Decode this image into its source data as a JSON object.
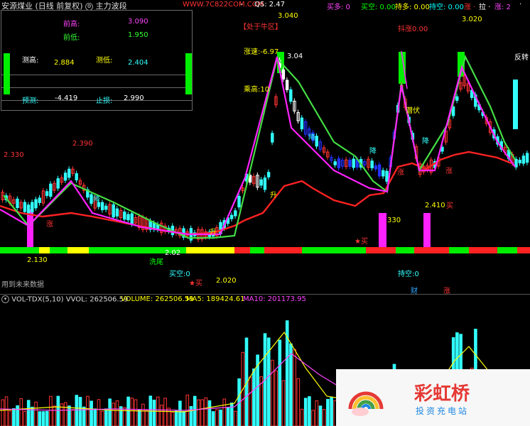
{
  "header": {
    "stock_name": "安源煤业",
    "period_label": "(日线 前复权)",
    "indicator_name": "主力波段",
    "watermark": "WWW.7C822COM.COM",
    "dash": "-",
    "qs": "QS: 2.47",
    "buy_many": "买多: 0",
    "buy_empty": "买空: 0.00",
    "hold_many": "持多: 0.00",
    "hold_empty": "持空: 0.00",
    "zhang": "涨 ·",
    "la": "拉 ·",
    "zhang2": "涨: 2",
    "tail": "·"
  },
  "info_panel": {
    "prev_high_label": "前高:",
    "prev_high_value": "3.090",
    "prev_low_label": "前低:",
    "prev_low_value": "1.950",
    "measure_high_label": "测高:",
    "measure_high_value": "2.884",
    "measure_low_label": "测低:",
    "measure_low_value": "2.404",
    "forecast_label": "预测:",
    "forecast_value": "-4.419",
    "stop_loss_label": "止损:",
    "stop_loss_value": "2.990"
  },
  "chart_labels": {
    "p3040": "3.040",
    "bull_zone": "【处于牛区】",
    "speed": "涨速:-6.97",
    "p304": "3.04",
    "ratio_high": "乘高:10",
    "p2330": "2.330",
    "p2390": "2.390",
    "p2130": "2.130",
    "p202": "2.02",
    "wash_tail": "洗尾",
    "p2020": "2.020",
    "buy_empty_marker": "买空:0",
    "buy_star": "★买",
    "buy_star2": "★买",
    "p330": "330",
    "p2410": "2.410",
    "buy_right": "买",
    "hold_empty_marker": "持空:0",
    "cai": "财",
    "zhang_bottom": "涨",
    "p3020": "3.020",
    "raise_flag": "抖涨0.00",
    "fanzhuan": "反转",
    "jiang1": "降",
    "jiang2": "降",
    "jiang3": "降",
    "jiang4": "降",
    "sheng1": "升",
    "sheng2": "升",
    "zhang_m": "涨",
    "zhang_m2": "涨",
    "zhang_m3": "涨",
    "luan": "潜伏",
    "future_data": "用到未来数据"
  },
  "volume": {
    "title": "VOL-TDX(5,10)",
    "vvol": "VVOL: 262506.59",
    "volume": "VOLUME: 262506.59",
    "ma5": "MA5: 189424.61",
    "ma10": "MA10: 201173.95"
  },
  "logo": {
    "name": "彩虹桥",
    "tagline": "投资充电站"
  },
  "colors": {
    "up": "#ff3333",
    "down": "#33ffff",
    "blue": "#2233ff",
    "green_line": "#44dd44",
    "magenta": "#ff22ff",
    "yellow": "#ffff00",
    "white": "#ffffff"
  }
}
